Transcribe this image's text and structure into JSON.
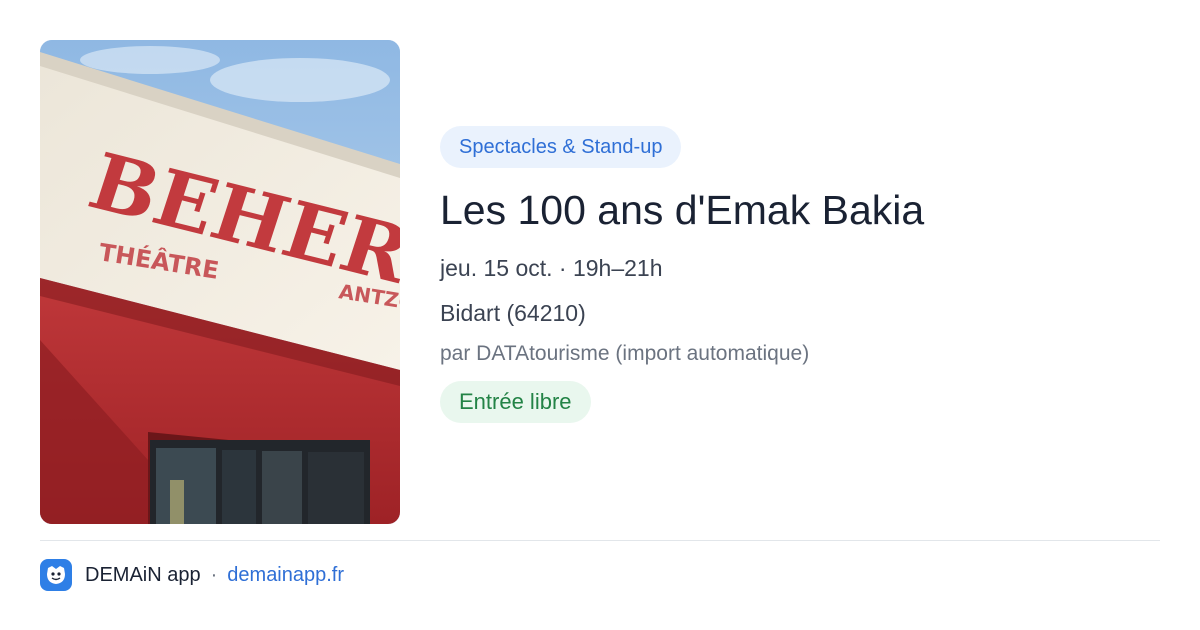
{
  "event": {
    "category": "Spectacles & Stand-up",
    "title": "Les 100 ans d'Emak Bakia",
    "datetime": "jeu. 15 oct. · 19h–21h",
    "location": "Bidart (64210)",
    "organizer": "par DATAtourisme (import automatique)",
    "price": "Entrée libre"
  },
  "photo": {
    "sign_main": "BEHERI",
    "sign_theatre": "THÉÂTRE",
    "sign_sub": "ANTZO"
  },
  "footer": {
    "app_name": "DEMAiN app",
    "separator": "·",
    "url": "demainapp.fr"
  },
  "colors": {
    "accent": "#2f6fd6",
    "category_bg": "#eaf2fd",
    "price_text": "#238346",
    "price_bg": "#e9f7ee",
    "title": "#1a2233",
    "facade_red": "#b52a2e"
  },
  "icons": {
    "app_logo": "demain-app-logo-icon"
  }
}
